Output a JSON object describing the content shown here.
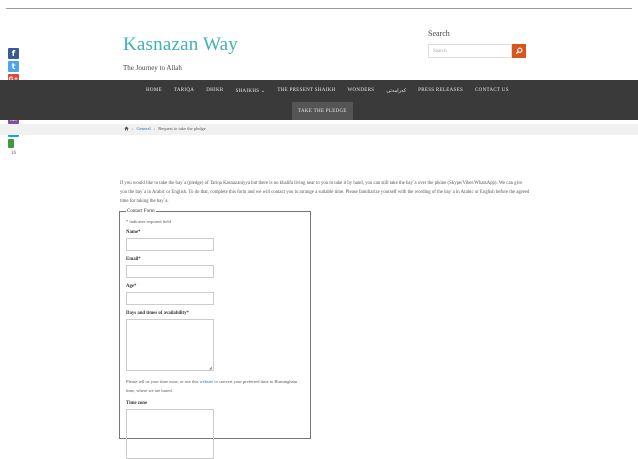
{
  "site": {
    "title": "Kasnazan Way",
    "tagline": "The Journey to Allah"
  },
  "search": {
    "heading": "Search",
    "placeholder": "Search",
    "button_icon": "search-icon"
  },
  "social": {
    "icons": [
      "facebook-icon",
      "twitter-icon",
      "google-plus-icon",
      "email-icon",
      "whatsapp-icon",
      "viber-icon",
      "skype-icon",
      "sms-icon"
    ],
    "colors": {
      "facebook": "#3b5998",
      "twitter": "#4aa8e8",
      "google_plus": "#dc4a38",
      "email": "#2a6ebb",
      "whatsapp": "#2bb741",
      "viber": "#7d52a0",
      "skype": "#12a5e9",
      "sms": "#3e9a3e"
    },
    "count": "16"
  },
  "nav": {
    "items": [
      "HOME",
      "TARIQA",
      "DHIKR",
      "SHAIKHS",
      "THE PRESENT SHAIKH",
      "WONDERS",
      "کەرامەتی",
      "PRESS RELEASES",
      "CONTACT US"
    ],
    "row2": [
      "TAKE THE PLEDGE"
    ]
  },
  "breadcrumb": {
    "home_icon": "home-icon",
    "items": [
      "General",
      "Request to take the pledge"
    ],
    "separator": "›"
  },
  "intro": "If you would like to take the bay`a (pledge) of Tariqa Kasnazaniyya but there is no khalifa living near to you to take it by hand, you can still take the bay`a over the phone (Skype/Viber/WhatsApp). We can give you the bay`a in Arabic or English. To do that, complete this form and we will contact you to arrange a suitable time. Please familiarize yourself with the wording of the bay`a in Arabic or English before the agreed time for taking the bay`a.",
  "form": {
    "legend": "Contact Form",
    "required_note": "* indicates required field",
    "name_label": "Name*",
    "email_label": "Email*",
    "age_label": "Age*",
    "days_label": "Days and times of availability*",
    "help_before": "Please tell us your time zone, or use this ",
    "help_link": "website",
    "help_after": " to convert your preferred time to Birmingham time, where we are based.",
    "timezone_label": "Time zone"
  },
  "colors": {
    "title": "#3fb2b2",
    "nav_bg": "#3a3a3a",
    "search_button": "#d9541e",
    "link": "#3a6fb0"
  }
}
